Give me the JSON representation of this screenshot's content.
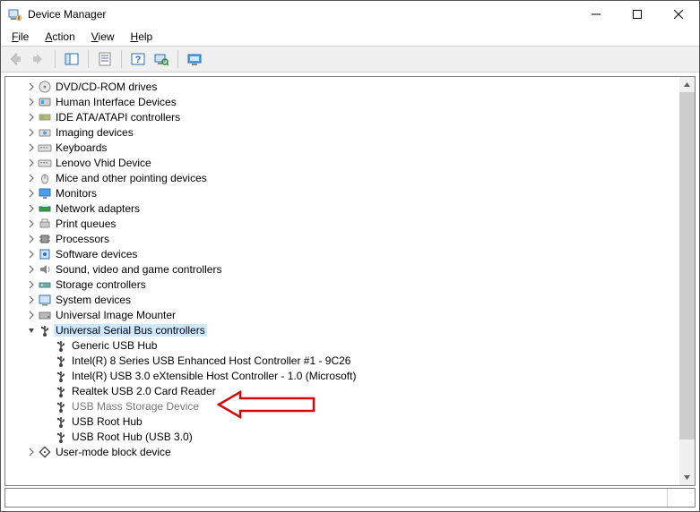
{
  "window": {
    "title": "Device Manager"
  },
  "menu": {
    "file": "File",
    "action": "Action",
    "view": "View",
    "help": "Help"
  },
  "toolbar": {
    "back": "Back",
    "forward": "Forward",
    "show_hide_console_tree": "Show/Hide Console Tree",
    "properties": "Properties",
    "help": "Help",
    "scan_hardware": "Scan for hardware changes",
    "view_devices": "View devices"
  },
  "tree": {
    "nodes": [
      {
        "label": "DVD/CD-ROM drives",
        "icon": "disc-icon",
        "depth": 1,
        "expander": "closed"
      },
      {
        "label": "Human Interface Devices",
        "icon": "hid-icon",
        "depth": 1,
        "expander": "closed"
      },
      {
        "label": "IDE ATA/ATAPI controllers",
        "icon": "ide-icon",
        "depth": 1,
        "expander": "closed"
      },
      {
        "label": "Imaging devices",
        "icon": "imaging-icon",
        "depth": 1,
        "expander": "closed"
      },
      {
        "label": "Keyboards",
        "icon": "keyboard-icon",
        "depth": 1,
        "expander": "closed"
      },
      {
        "label": "Lenovo Vhid Device",
        "icon": "keyboard-icon",
        "depth": 1,
        "expander": "closed"
      },
      {
        "label": "Mice and other pointing devices",
        "icon": "mouse-icon",
        "depth": 1,
        "expander": "closed"
      },
      {
        "label": "Monitors",
        "icon": "monitor-icon",
        "depth": 1,
        "expander": "closed"
      },
      {
        "label": "Network adapters",
        "icon": "network-icon",
        "depth": 1,
        "expander": "closed"
      },
      {
        "label": "Print queues",
        "icon": "printer-icon",
        "depth": 1,
        "expander": "closed"
      },
      {
        "label": "Processors",
        "icon": "cpu-icon",
        "depth": 1,
        "expander": "closed"
      },
      {
        "label": "Software devices",
        "icon": "software-icon",
        "depth": 1,
        "expander": "closed"
      },
      {
        "label": "Sound, video and game controllers",
        "icon": "sound-icon",
        "depth": 1,
        "expander": "closed"
      },
      {
        "label": "Storage controllers",
        "icon": "storage-icon",
        "depth": 1,
        "expander": "closed"
      },
      {
        "label": "System devices",
        "icon": "system-icon",
        "depth": 1,
        "expander": "closed"
      },
      {
        "label": "Universal Image Mounter",
        "icon": "disk-icon",
        "depth": 1,
        "expander": "closed"
      },
      {
        "label": "Universal Serial Bus controllers",
        "icon": "usb-icon",
        "depth": 1,
        "expander": "open",
        "selected": true
      },
      {
        "label": "Generic USB Hub",
        "icon": "usb-icon",
        "depth": 2,
        "expander": "none"
      },
      {
        "label": "Intel(R) 8 Series USB Enhanced Host Controller #1 - 9C26",
        "icon": "usb-icon",
        "depth": 2,
        "expander": "none"
      },
      {
        "label": "Intel(R) USB 3.0 eXtensible Host Controller - 1.0 (Microsoft)",
        "icon": "usb-icon",
        "depth": 2,
        "expander": "none"
      },
      {
        "label": "Realtek USB 2.0 Card Reader",
        "icon": "usb-icon",
        "depth": 2,
        "expander": "none"
      },
      {
        "label": "USB Mass Storage Device",
        "icon": "usb-icon",
        "depth": 2,
        "expander": "none",
        "dim": true
      },
      {
        "label": "USB Root Hub",
        "icon": "usb-icon",
        "depth": 2,
        "expander": "none"
      },
      {
        "label": "USB Root Hub (USB 3.0)",
        "icon": "usb-icon",
        "depth": 2,
        "expander": "none"
      },
      {
        "label": "User-mode block device",
        "icon": "block-icon",
        "depth": 1,
        "expander": "closed"
      }
    ]
  },
  "annotation": {
    "target_label": "USB Mass Storage Device",
    "color": "#d40909"
  }
}
